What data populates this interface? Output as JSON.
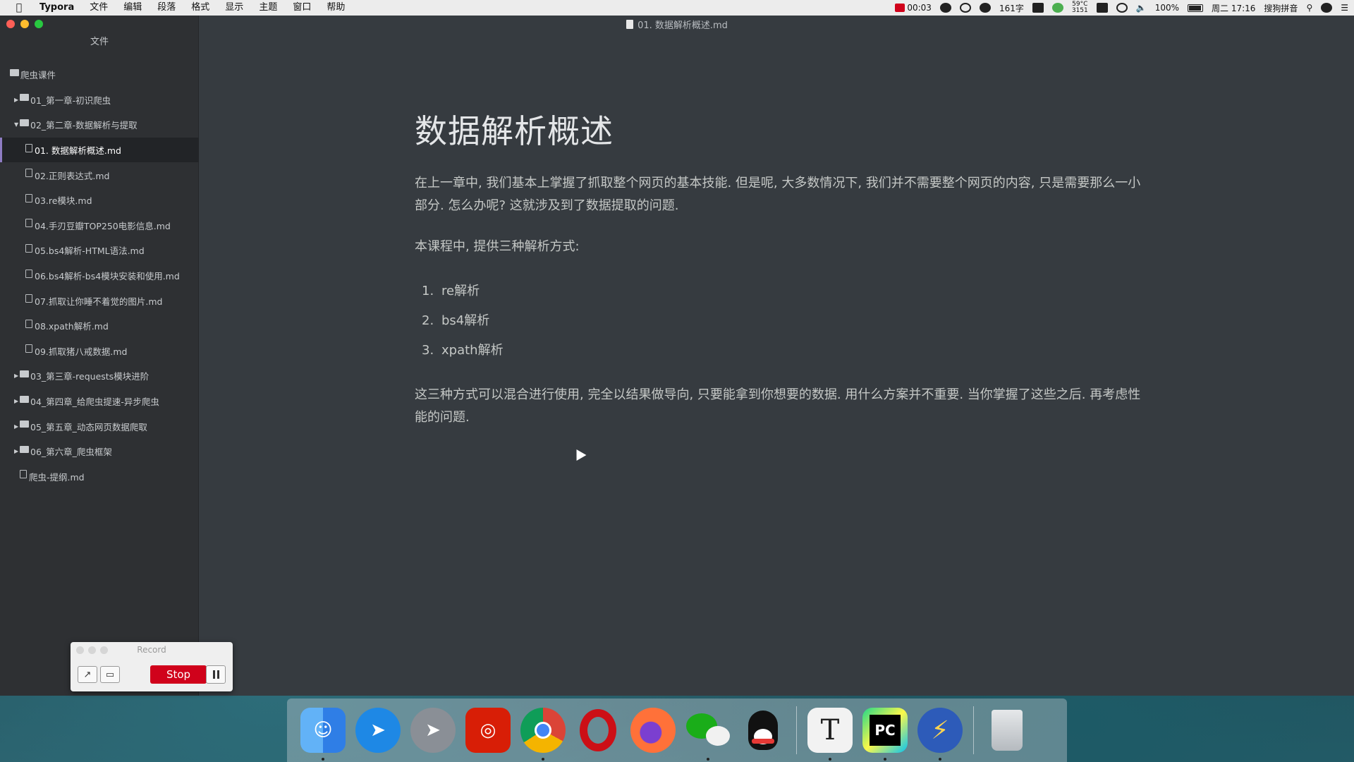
{
  "menubar": {
    "app_name": "Typora",
    "items": [
      "文件",
      "编辑",
      "段落",
      "格式",
      "显示",
      "主题",
      "窗口",
      "帮助"
    ],
    "rec_time": "00:03",
    "word_count": "161字",
    "temp_top": "59°C",
    "temp_bottom": "3151",
    "battery": "100%",
    "clock": "周二 17:16",
    "ime": "搜狗拼音"
  },
  "window": {
    "title": "01. 数据解析概述.md"
  },
  "sidebar": {
    "header": "文件",
    "root": "爬虫课件",
    "ch1": "01_第一章-初识爬虫",
    "ch2": "02_第二章-数据解析与提取",
    "files": [
      "01. 数据解析概述.md",
      "02.正则表达式.md",
      "03.re模块.md",
      "04.手刃豆瓣TOP250电影信息.md",
      "05.bs4解析-HTML语法.md",
      "06.bs4解析-bs4模块安装和使用.md",
      "07.抓取让你睡不着觉的图片.md",
      "08.xpath解析.md",
      "09.抓取猪八戒数据.md"
    ],
    "ch3": "03_第三章-requests模块进阶",
    "ch4": "04_第四章_给爬虫提速-异步爬虫",
    "ch5": "05_第五章_动态网页数据爬取",
    "ch6": "06_第六章_爬虫框架",
    "outline": "爬虫-提纲.md"
  },
  "editor": {
    "heading": "数据解析概述",
    "para1": "在上一章中, 我们基本上掌握了抓取整个网页的基本技能. 但是呢, 大多数情况下, 我们并不需要整个网页的内容, 只是需要那么一小部分. 怎么办呢? 这就涉及到了数据提取的问题.",
    "para2": "本课程中, 提供三种解析方式:",
    "list": [
      {
        "num": "1.",
        "text": "re解析"
      },
      {
        "num": "2.",
        "text": "bs4解析"
      },
      {
        "num": "3.",
        "text": "xpath解析"
      }
    ],
    "para3": "这三种方式可以混合进行使用, 完全以结果做导向, 只要能拿到你想要的数据. 用什么方案并不重要. 当你掌握了这些之后. 再考虑性能的问题."
  },
  "record": {
    "title": "Record",
    "stop_label": "Stop"
  },
  "dock": {
    "apps": [
      {
        "name": "Finder",
        "icon": "finder-icon",
        "color": "#3d8fe0"
      },
      {
        "name": "Safari",
        "icon": "safari-icon",
        "color": "#1e88e5"
      },
      {
        "name": "Launchpad",
        "icon": "launchpad-icon",
        "color": "#8a8f96"
      },
      {
        "name": "NetEase Music",
        "icon": "netease-music-icon",
        "color": "#d81e06"
      },
      {
        "name": "Chrome",
        "icon": "chrome-icon",
        "color": "#e8e8e8"
      },
      {
        "name": "Opera",
        "icon": "opera-icon",
        "color": "#cc0f16"
      },
      {
        "name": "Firefox",
        "icon": "firefox-icon",
        "color": "#ff7139"
      },
      {
        "name": "WeChat",
        "icon": "wechat-icon",
        "color": "#1aad19"
      },
      {
        "name": "QQ",
        "icon": "qq-icon",
        "color": "#111111"
      },
      {
        "name": "Typora",
        "icon": "typora-icon",
        "color": "#f2f2f2"
      },
      {
        "name": "PyCharm",
        "icon": "pycharm-icon",
        "color": "#21d789"
      },
      {
        "name": "Thunder",
        "icon": "thunder-icon",
        "color": "#2d5bb9"
      },
      {
        "name": "Trash",
        "icon": "trash-icon",
        "color": "#c8ccd0"
      }
    ],
    "glyphs": {
      "typora": "T",
      "pycharm": "PC"
    }
  }
}
